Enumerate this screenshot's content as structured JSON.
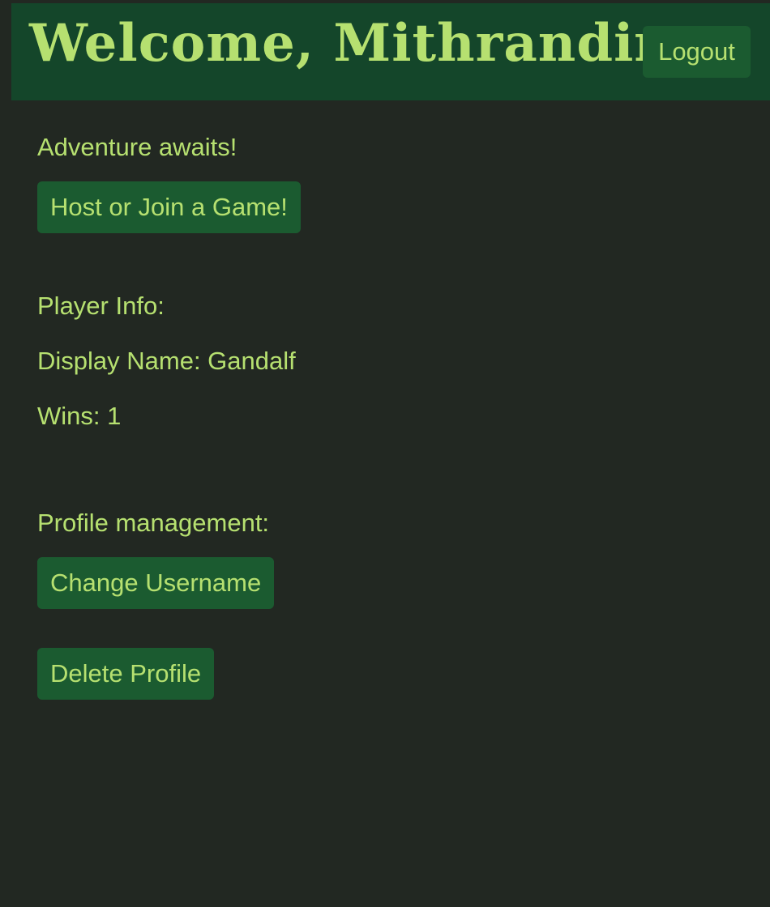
{
  "header": {
    "title": "Welcome, Mithrandir",
    "logout_label": "Logout"
  },
  "main": {
    "tagline": "Adventure awaits!",
    "host_join_label": "Host or Join a Game!",
    "player_info": {
      "heading": "Player Info:",
      "display_name_label": "Display Name: Gandalf",
      "wins_label": "Wins: 1"
    },
    "profile": {
      "heading": "Profile management:",
      "change_username_label": "Change Username",
      "delete_profile_label": "Delete Profile"
    }
  },
  "colors": {
    "background": "#222822",
    "header_bg": "#14462a",
    "button_bg": "#1b5b30",
    "text": "#b6e070"
  }
}
